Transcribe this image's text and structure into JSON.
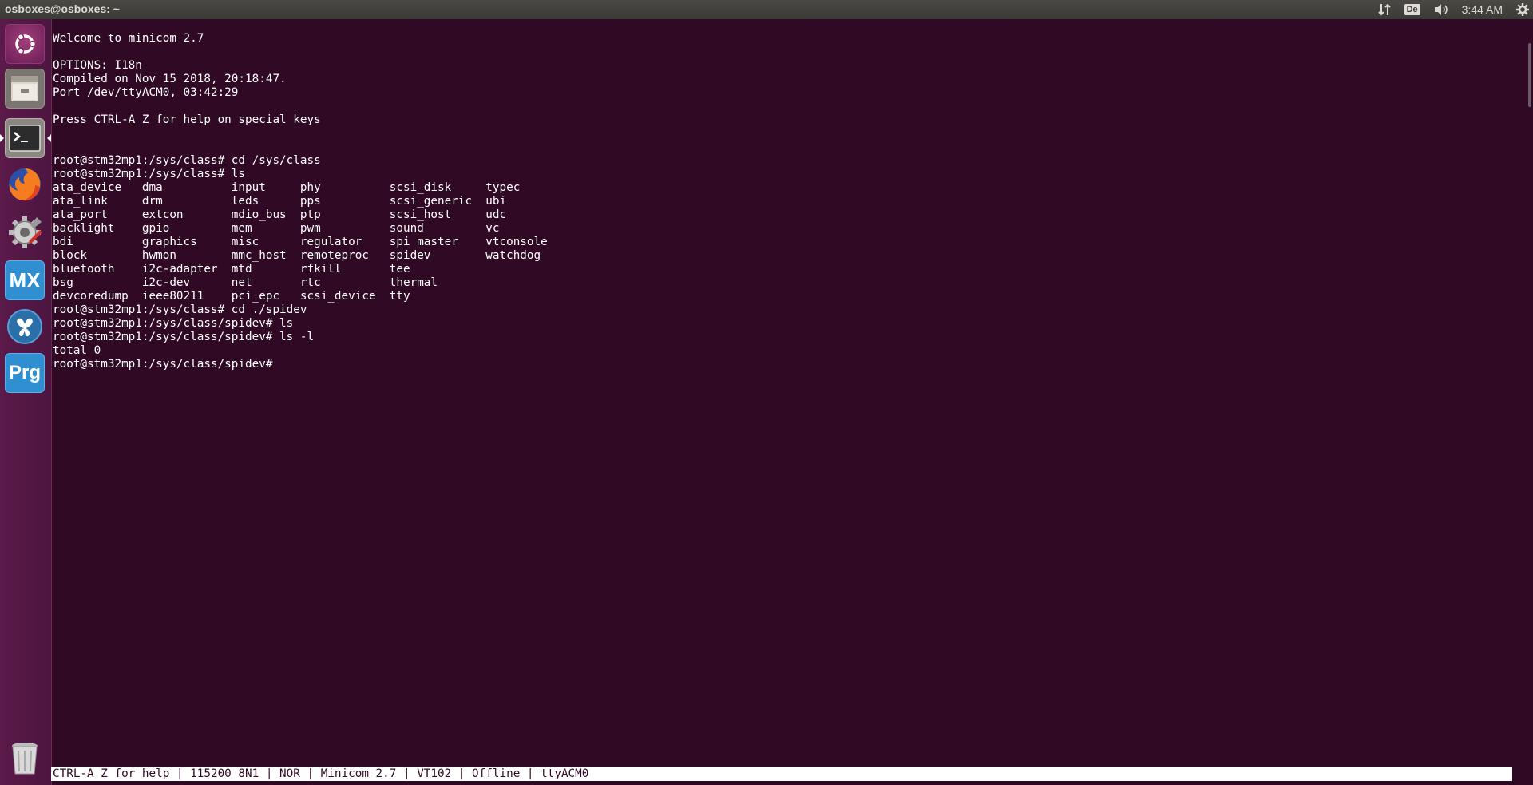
{
  "top_panel": {
    "title": "osboxes@osboxes: ~",
    "keyboard_layout": "De",
    "time": "3:44 AM"
  },
  "launcher": {
    "items": [
      "ubuntu-dash",
      "files",
      "terminal",
      "firefox",
      "system-settings",
      "stm32cubemx",
      "stm32cubeide",
      "stm32cubeprogrammer",
      "trash"
    ]
  },
  "terminal": {
    "lines": [
      "Welcome to minicom 2.7",
      "",
      "OPTIONS: I18n",
      "Compiled on Nov 15 2018, 20:18:47.",
      "Port /dev/ttyACM0, 03:42:29",
      "",
      "Press CTRL-A Z for help on special keys",
      "",
      "",
      "root@stm32mp1:/sys/class# cd /sys/class",
      "root@stm32mp1:/sys/class# ls",
      "ata_device   dma          input     phy          scsi_disk     typec",
      "ata_link     drm          leds      pps          scsi_generic  ubi",
      "ata_port     extcon       mdio_bus  ptp          scsi_host     udc",
      "backlight    gpio         mem       pwm          sound         vc",
      "bdi          graphics     misc      regulator    spi_master    vtconsole",
      "block        hwmon        mmc_host  remoteproc   spidev        watchdog",
      "bluetooth    i2c-adapter  mtd       rfkill       tee",
      "bsg          i2c-dev      net       rtc          thermal",
      "devcoredump  ieee80211    pci_epc   scsi_device  tty",
      "root@stm32mp1:/sys/class# cd ./spidev",
      "root@stm32mp1:/sys/class/spidev# ls",
      "root@stm32mp1:/sys/class/spidev# ls -l",
      "total 0",
      "root@stm32mp1:/sys/class/spidev#"
    ]
  },
  "status_bar": {
    "text": "CTRL-A Z for help | 115200 8N1 | NOR | Minicom 2.7 | VT102 | Offline | ttyACM0"
  },
  "colors": {
    "terminal_bg": "#300a24",
    "launcher_bg": "#5b1a4a",
    "panel_bg": "#3c3b37"
  }
}
